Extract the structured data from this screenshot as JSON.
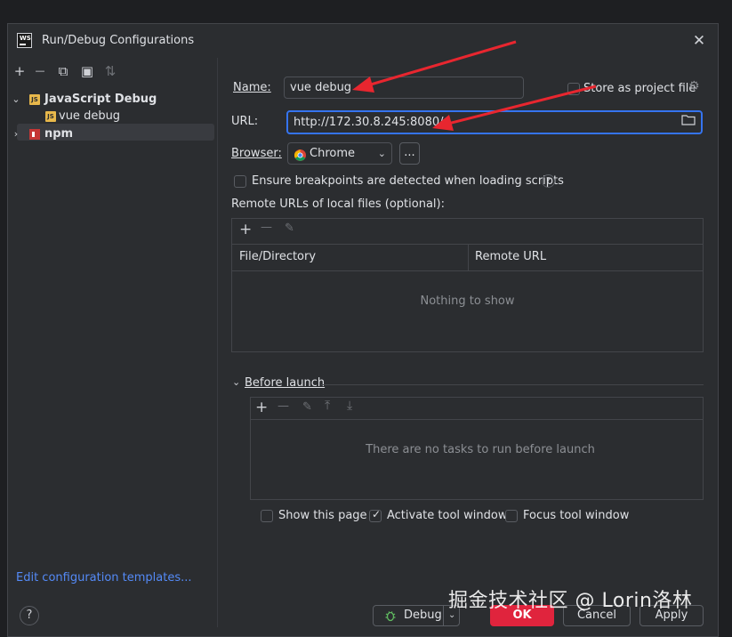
{
  "window": {
    "title": "Run/Debug Configurations",
    "logo_text": "WS"
  },
  "toolbar": {
    "add": "+",
    "remove": "—",
    "copy": "⧉",
    "folder": "▣",
    "sort": "⇅"
  },
  "tree": {
    "group1": {
      "label": "JavaScript Debug",
      "badge": "JS"
    },
    "item1": {
      "label": "vue debug",
      "badge": "JS"
    },
    "group2": {
      "label": "npm"
    }
  },
  "left_footer": {
    "link": "Edit configuration templates..."
  },
  "form": {
    "name_label": "Name:",
    "name_value": "vue debug",
    "store_label": "Store as project file",
    "url_label": "URL:",
    "url_value": "http://172.30.8.245:8080/",
    "browser_label": "Browser:",
    "browser_value": "Chrome",
    "browser_more": "...",
    "ensure_label": "Ensure breakpoints are detected when loading scripts",
    "remote_label": "Remote URLs of local files (optional):"
  },
  "remote_table": {
    "columns": [
      "File/Directory",
      "Remote URL"
    ],
    "empty": "Nothing to show"
  },
  "before_launch": {
    "label": "Before launch",
    "empty": "There are no tasks to run before launch"
  },
  "options": {
    "show_page": {
      "label": "Show this page",
      "checked": false
    },
    "activate_tool": {
      "label": "Activate tool window",
      "checked": true
    },
    "focus_tool": {
      "label": "Focus tool window",
      "checked": false
    }
  },
  "buttons": {
    "help": "?",
    "debug": "Debug",
    "ok": "OK",
    "cancel": "Cancel",
    "apply": "Apply"
  },
  "watermark": "掘金技术社区 @ Lorin洛林",
  "colors": {
    "accent": "#3574f0",
    "ok_button": "#e0243d",
    "arrow": "#e8262f",
    "link": "#548af7"
  }
}
